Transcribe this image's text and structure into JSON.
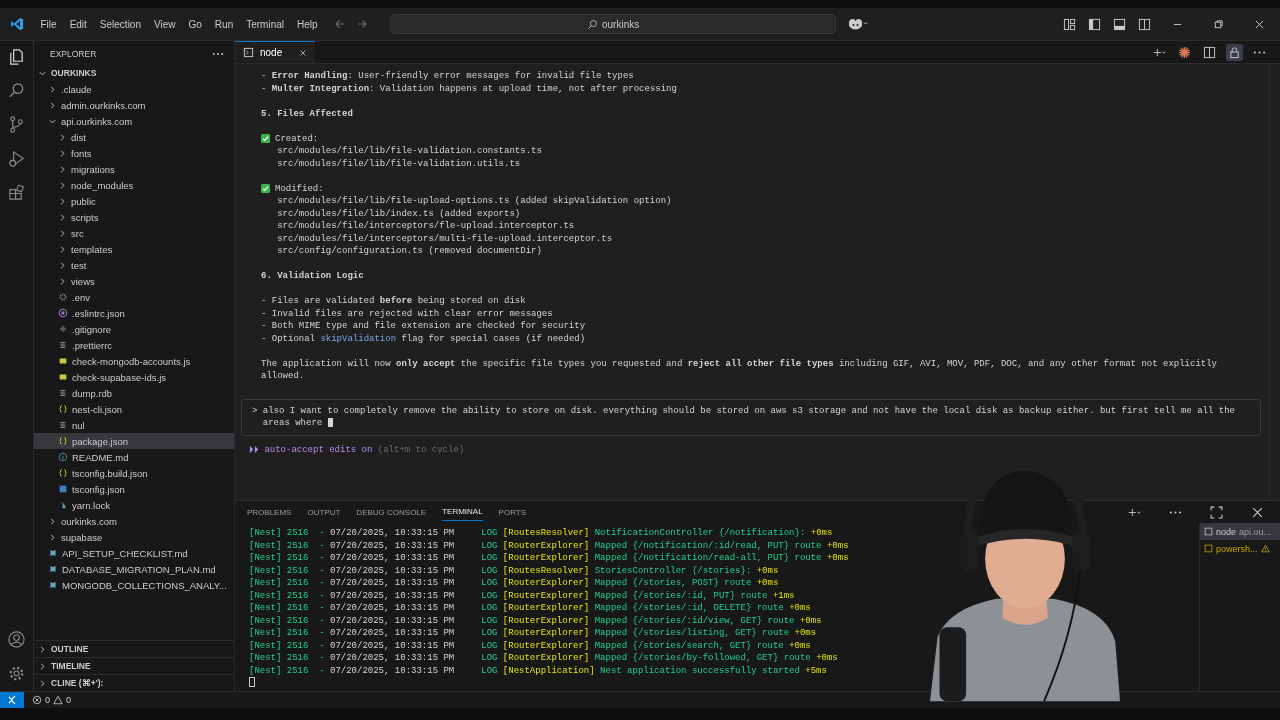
{
  "window": {
    "menu": [
      "File",
      "Edit",
      "Selection",
      "View",
      "Go",
      "Run",
      "Terminal",
      "Help"
    ],
    "search": "ourkinks"
  },
  "sidebar": {
    "title": "EXPLORER",
    "root": "OURKINKS",
    "tree": [
      {
        "label": ".claude",
        "kind": "folder",
        "expanded": false,
        "selected": false
      },
      {
        "label": "admin.ourkinks.com",
        "kind": "folder",
        "expanded": false,
        "selected": false
      },
      {
        "label": "api.ourkinks.com",
        "kind": "folder",
        "expanded": true,
        "selected": false,
        "children": [
          {
            "label": "dist",
            "kind": "folder",
            "expanded": false,
            "selected": false
          },
          {
            "label": "fonts",
            "kind": "folder",
            "expanded": false,
            "selected": false
          },
          {
            "label": "migrations",
            "kind": "folder",
            "expanded": false,
            "selected": false
          },
          {
            "label": "node_modules",
            "kind": "folder",
            "expanded": false,
            "selected": false
          },
          {
            "label": "public",
            "kind": "folder",
            "expanded": false,
            "selected": false
          },
          {
            "label": "scripts",
            "kind": "folder",
            "expanded": false,
            "selected": false
          },
          {
            "label": "src",
            "kind": "folder",
            "expanded": false,
            "selected": false
          },
          {
            "label": "templates",
            "kind": "folder",
            "expanded": false,
            "selected": false
          },
          {
            "label": "test",
            "kind": "folder",
            "expanded": false,
            "selected": false
          },
          {
            "label": "views",
            "kind": "folder",
            "expanded": false,
            "selected": false
          },
          {
            "label": ".env",
            "kind": "gear",
            "selected": false
          },
          {
            "label": ".eslintrc.json",
            "kind": "eslint",
            "selected": false
          },
          {
            "label": ".gitignore",
            "kind": "diamond",
            "selected": false
          },
          {
            "label": ".prettierrc",
            "kind": "lines",
            "selected": false
          },
          {
            "label": "check-mongodb-accounts.js",
            "kind": "js",
            "selected": false
          },
          {
            "label": "check-supabase-ids.js",
            "kind": "js",
            "selected": false
          },
          {
            "label": "dump.rdb",
            "kind": "lines",
            "selected": false
          },
          {
            "label": "nest-cli.json",
            "kind": "braces",
            "selected": false
          },
          {
            "label": "nul",
            "kind": "lines",
            "selected": false
          },
          {
            "label": "package.json",
            "kind": "braces",
            "selected": true
          },
          {
            "label": "README.md",
            "kind": "info",
            "selected": false
          },
          {
            "label": "tsconfig.build.json",
            "kind": "braces",
            "selected": false
          },
          {
            "label": "tsconfig.json",
            "kind": "ts",
            "selected": false
          },
          {
            "label": "yarn.lock",
            "kind": "yarn",
            "selected": false
          }
        ]
      },
      {
        "label": "ourkinks.com",
        "kind": "folder",
        "expanded": false,
        "selected": false
      },
      {
        "label": "supabase",
        "kind": "folder",
        "expanded": false,
        "selected": false
      },
      {
        "label": "API_SETUP_CHECKLIST.md",
        "kind": "md",
        "selected": false
      },
      {
        "label": "DATABASE_MIGRATION_PLAN.md",
        "kind": "md",
        "selected": false
      },
      {
        "label": "MONGODB_COLLECTIONS_ANALY...",
        "kind": "md",
        "selected": false
      }
    ],
    "sections": [
      {
        "label": "OUTLINE",
        "expanded": false
      },
      {
        "label": "TIMELINE",
        "expanded": false
      },
      {
        "label": "CLINE (⌘+'):",
        "expanded": false
      }
    ]
  },
  "tabs": [
    {
      "label": "node",
      "selected": true
    }
  ],
  "editor": {
    "blocks": [
      [
        {
          "kind": "plain",
          "parts": [
            {
              "text": "- "
            },
            {
              "text": "Error Handling",
              "kind": "bold"
            },
            {
              "text": ": User-friendly error messages for invalid file types"
            }
          ]
        },
        {
          "kind": "plain",
          "parts": [
            {
              "text": "- "
            },
            {
              "text": "Multer Integration",
              "kind": "bold"
            },
            {
              "text": ": Validation happens at upload time, not after processing"
            }
          ]
        }
      ],
      [
        {
          "kind": "heading",
          "parts": [
            {
              "text": "5. Files Affected"
            }
          ]
        }
      ],
      [
        {
          "kind": "check",
          "parts": [
            {
              "text": "Created:"
            }
          ]
        },
        {
          "kind": "path",
          "parts": [
            {
              "text": "src/modules/file/lib/file-validation.constants.ts"
            }
          ]
        },
        {
          "kind": "path",
          "parts": [
            {
              "text": "src/modules/file/lib/file-validation.utils.ts"
            }
          ]
        }
      ],
      [
        {
          "kind": "check",
          "parts": [
            {
              "text": "Modified:"
            }
          ]
        },
        {
          "kind": "path",
          "parts": [
            {
              "text": "src/modules/file/lib/file-upload-options.ts (added skipValidation option)"
            }
          ]
        },
        {
          "kind": "path",
          "parts": [
            {
              "text": "src/modules/file/lib/index.ts (added exports)"
            }
          ]
        },
        {
          "kind": "path",
          "parts": [
            {
              "text": "src/modules/file/interceptors/fle-upload.interceptor.ts"
            }
          ]
        },
        {
          "kind": "path",
          "parts": [
            {
              "text": "src/modules/file/interceptors/multi-file-upload.interceptor.ts"
            }
          ]
        },
        {
          "kind": "path",
          "parts": [
            {
              "text": "src/config/configuration.ts (removed documentDir)"
            }
          ]
        }
      ],
      [
        {
          "kind": "heading",
          "parts": [
            {
              "text": "6. Validation Logic"
            }
          ]
        }
      ],
      [
        {
          "kind": "plain",
          "parts": [
            {
              "text": "- Files are validated "
            },
            {
              "text": "before",
              "kind": "bold"
            },
            {
              "text": " being stored on disk"
            }
          ]
        },
        {
          "kind": "plain",
          "parts": [
            {
              "text": "- Invalid files are rejected with clear error messages"
            }
          ]
        },
        {
          "kind": "plain",
          "parts": [
            {
              "text": "- Both MIME type and file extension are checked for security"
            }
          ]
        },
        {
          "kind": "plain",
          "parts": [
            {
              "text": "- Optional "
            },
            {
              "text": "skipValidation",
              "kind": "code"
            },
            {
              "text": " flag for special cases (if needed)"
            }
          ]
        }
      ],
      [
        {
          "kind": "plain",
          "parts": [
            {
              "text": "The application will now "
            },
            {
              "text": "only accept",
              "kind": "bold"
            },
            {
              "text": " the specific file types you requested and "
            },
            {
              "text": "reject all other file types",
              "kind": "bold"
            },
            {
              "text": " including GIF, AVI, MOV, PDF, DOC, and any other format not explicitly allowed."
            }
          ]
        }
      ]
    ],
    "prompt": {
      "symbol": ">",
      "text": "also I want to completely remove the ability to store on disk. everything should be stored on aws s3 storage and not have the local disk as backup either. but first tell me all the areas where"
    },
    "mode": {
      "marker": "⏵⏵",
      "label": "auto-accept edits on",
      "hint": "(alt+m to cycle)"
    }
  },
  "panel": {
    "tabs": [
      {
        "label": "PROBLEMS",
        "selected": false
      },
      {
        "label": "OUTPUT",
        "selected": false
      },
      {
        "label": "DEBUG CONSOLE",
        "selected": false
      },
      {
        "label": "TERMINAL",
        "selected": true
      },
      {
        "label": "PORTS",
        "selected": false
      }
    ],
    "terminal": [
      {
        "prefix": "[Nest] 2516  -",
        "time": "07/20/2025, 10:33:15 PM",
        "level": "LOG",
        "context": "[RoutesResolver]",
        "message": "NotificationController {/notification}:",
        "duration": "+0ms"
      },
      {
        "prefix": "[Nest] 2516  -",
        "time": "07/20/2025, 10:33:15 PM",
        "level": "LOG",
        "context": "[RouterExplorer]",
        "message": "Mapped {/notification/:id/read, PUT} route",
        "duration": "+0ms"
      },
      {
        "prefix": "[Nest] 2516  -",
        "time": "07/20/2025, 10:33:15 PM",
        "level": "LOG",
        "context": "[RouterExplorer]",
        "message": "Mapped {/notification/read-all, PUT} route",
        "duration": "+0ms"
      },
      {
        "prefix": "[Nest] 2516  -",
        "time": "07/20/2025, 10:33:15 PM",
        "level": "LOG",
        "context": "[RoutesResolver]",
        "message": "StoriesController {/stories}:",
        "duration": "+0ms"
      },
      {
        "prefix": "[Nest] 2516  -",
        "time": "07/20/2025, 10:33:15 PM",
        "level": "LOG",
        "context": "[RouterExplorer]",
        "message": "Mapped {/stories, POST} route",
        "duration": "+0ms"
      },
      {
        "prefix": "[Nest] 2516  -",
        "time": "07/20/2025, 10:33:15 PM",
        "level": "LOG",
        "context": "[RouterExplorer]",
        "message": "Mapped {/stories/:id, PUT} route",
        "duration": "+1ms"
      },
      {
        "prefix": "[Nest] 2516  -",
        "time": "07/20/2025, 10:33:15 PM",
        "level": "LOG",
        "context": "[RouterExplorer]",
        "message": "Mapped {/stories/:id, DELETE} route",
        "duration": "+0ms"
      },
      {
        "prefix": "[Nest] 2516  -",
        "time": "07/20/2025, 10:33:15 PM",
        "level": "LOG",
        "context": "[RouterExplorer]",
        "message": "Mapped {/stories/:id/view, GET} route",
        "duration": "+0ms"
      },
      {
        "prefix": "[Nest] 2516  -",
        "time": "07/20/2025, 10:33:15 PM",
        "level": "LOG",
        "context": "[RouterExplorer]",
        "message": "Mapped {/stories/listing, GET} route",
        "duration": "+0ms"
      },
      {
        "prefix": "[Nest] 2516  -",
        "time": "07/20/2025, 10:33:15 PM",
        "level": "LOG",
        "context": "[RouterExplorer]",
        "message": "Mapped {/stories/search, GET} route",
        "duration": "+0ms"
      },
      {
        "prefix": "[Nest] 2516  -",
        "time": "07/20/2025, 10:33:15 PM",
        "level": "LOG",
        "context": "[RouterExplorer]",
        "message": "Mapped {/stories/by-followed, GET} route",
        "duration": "+0ms"
      },
      {
        "prefix": "[Nest] 2516  -",
        "time": "07/20/2025, 10:33:15 PM",
        "level": "LOG",
        "context": "[NestApplication]",
        "message": "Nest application successfully started",
        "duration": "+5ms"
      }
    ],
    "instances": [
      {
        "name": "node",
        "detail": "api.ou...",
        "warning": false,
        "selected": true
      },
      {
        "name": "powersh...",
        "warning": true,
        "selected": false
      }
    ]
  },
  "status_bar": {
    "errors": "0",
    "warnings": "0"
  }
}
